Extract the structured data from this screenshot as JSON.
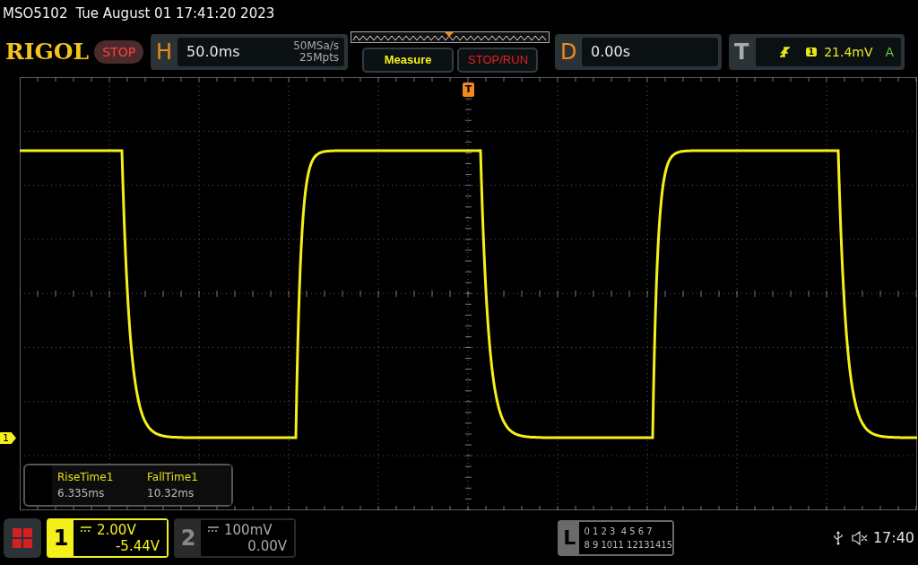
{
  "title_bar": {
    "model": "MSO5102",
    "datetime": "Tue August 01 17:41:20 2023"
  },
  "toolbar": {
    "logo": "RIGOL",
    "run_state": "STOP",
    "horizontal": {
      "label": "H",
      "timebase": "50.0ms",
      "sample_rate": "50MSa/s",
      "memory_depth": "25Mpts"
    },
    "buttons": [
      {
        "label": "Measure",
        "kind": "measure"
      },
      {
        "label": "STOP/RUN",
        "kind": "stoprun"
      }
    ],
    "delay": {
      "label": "D",
      "value": "0.00s"
    },
    "trigger": {
      "label": "T",
      "source": "1",
      "trigger_level": "21.4mV",
      "mode": "A"
    }
  },
  "display": {
    "trigger_marker": "T",
    "channel_marker": "1",
    "measurements": [
      {
        "name": "RiseTime1",
        "value": "6.335ms"
      },
      {
        "name": "FallTime1",
        "value": "10.32ms"
      }
    ]
  },
  "channels": [
    {
      "number": "1",
      "scale": "2.00V",
      "offset": "-5.44V",
      "selected": true
    },
    {
      "number": "2",
      "scale": "100mV",
      "offset": "0.00V",
      "selected": false
    }
  ],
  "logic": {
    "label": "L",
    "row_1": "0 1 2 3  4 5 6 7",
    "row_2": "8 9 1011 12131415"
  },
  "status": {
    "time": "17:40"
  }
}
